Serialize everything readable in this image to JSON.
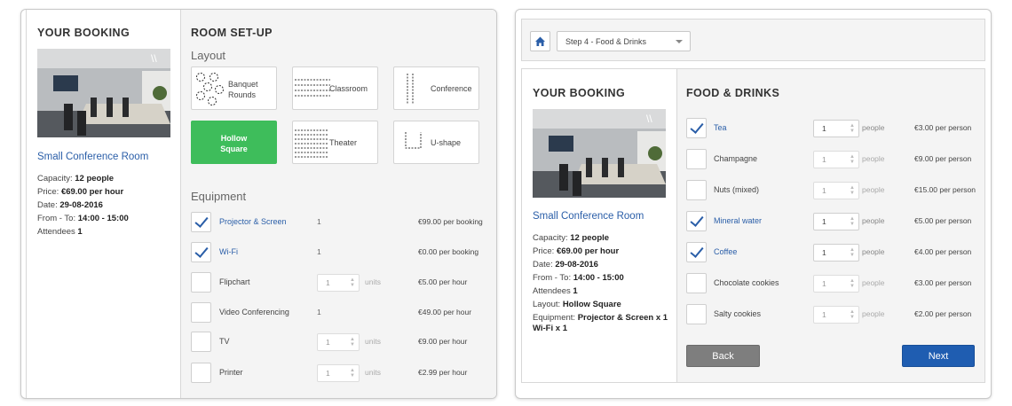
{
  "left": {
    "booking": {
      "title": "YOUR BOOKING",
      "room_name": "Small Conference Room",
      "details": [
        {
          "label": "Capacity: ",
          "value": "12 people"
        },
        {
          "label": "Price: ",
          "value": "€69.00 per hour"
        },
        {
          "label": "Date: ",
          "value": "29-08-2016"
        },
        {
          "label": "From - To: ",
          "value": "14:00 - 15:00"
        },
        {
          "label": "Attendees ",
          "value": "1"
        }
      ]
    },
    "setup": {
      "title": "ROOM SET-UP",
      "layout_label": "Layout",
      "layouts": [
        {
          "label": "Banquet Rounds",
          "icon": "banquet-icon",
          "selected": false
        },
        {
          "label": "Classroom",
          "icon": "classroom-icon",
          "selected": false
        },
        {
          "label": "Conference",
          "icon": "conference-icon",
          "selected": false
        },
        {
          "label": "Hollow Square",
          "icon": "",
          "selected": true
        },
        {
          "label": "Theater",
          "icon": "theater-icon",
          "selected": false
        },
        {
          "label": "U-shape",
          "icon": "u-shape-icon",
          "selected": false
        }
      ],
      "equipment_label": "Equipment",
      "equipment": [
        {
          "name": "Projector & Screen",
          "checked": true,
          "qty": "1",
          "price": "€99.00 per booking"
        },
        {
          "name": "Wi-Fi",
          "checked": true,
          "qty": "1",
          "price": "€0.00 per booking"
        },
        {
          "name": "Flipchart",
          "checked": false,
          "qty": "1",
          "units": "units",
          "price": "€5.00 per hour"
        },
        {
          "name": "Video Conferencing",
          "checked": false,
          "qty": "1",
          "price": "€49.00 per hour"
        },
        {
          "name": "TV",
          "checked": false,
          "qty": "1",
          "units": "units",
          "price": "€9.00 per hour"
        },
        {
          "name": "Printer",
          "checked": false,
          "qty": "1",
          "units": "units",
          "price": "€2.99 per hour"
        }
      ]
    }
  },
  "right": {
    "step_select": "Step 4 - Food & Drinks",
    "booking": {
      "title": "YOUR BOOKING",
      "room_name": "Small Conference Room",
      "details": [
        {
          "label": "Capacity: ",
          "value": "12 people"
        },
        {
          "label": "Price: ",
          "value": "€69.00 per hour"
        },
        {
          "label": "Date: ",
          "value": "29-08-2016"
        },
        {
          "label": "From - To: ",
          "value": "14:00 - 15:00"
        },
        {
          "label": "Attendees ",
          "value": "1"
        },
        {
          "label": "Layout: ",
          "value": "Hollow Square"
        },
        {
          "label": "Equipment: ",
          "value": "Projector & Screen x 1"
        },
        {
          "label": "",
          "value": "Wi-Fi x 1"
        }
      ]
    },
    "food": {
      "title": "FOOD & DRINKS",
      "items": [
        {
          "name": "Tea",
          "checked": true,
          "qty": "1",
          "unit": "people",
          "price": "€3.00 per person"
        },
        {
          "name": "Champagne",
          "checked": false,
          "qty": "1",
          "unit": "people",
          "price": "€9.00 per person"
        },
        {
          "name": "Nuts (mixed)",
          "checked": false,
          "qty": "1",
          "unit": "people",
          "price": "€15.00 per person"
        },
        {
          "name": "Mineral water",
          "checked": true,
          "qty": "1",
          "unit": "people",
          "price": "€5.00 per person"
        },
        {
          "name": "Coffee",
          "checked": true,
          "qty": "1",
          "unit": "people",
          "price": "€4.00 per person"
        },
        {
          "name": "Chocolate cookies",
          "checked": false,
          "qty": "1",
          "unit": "people",
          "price": "€3.00 per person"
        },
        {
          "name": "Salty cookies",
          "checked": false,
          "qty": "1",
          "unit": "people",
          "price": "€2.00 per person"
        }
      ],
      "back_label": "Back",
      "next_label": "Next"
    }
  }
}
